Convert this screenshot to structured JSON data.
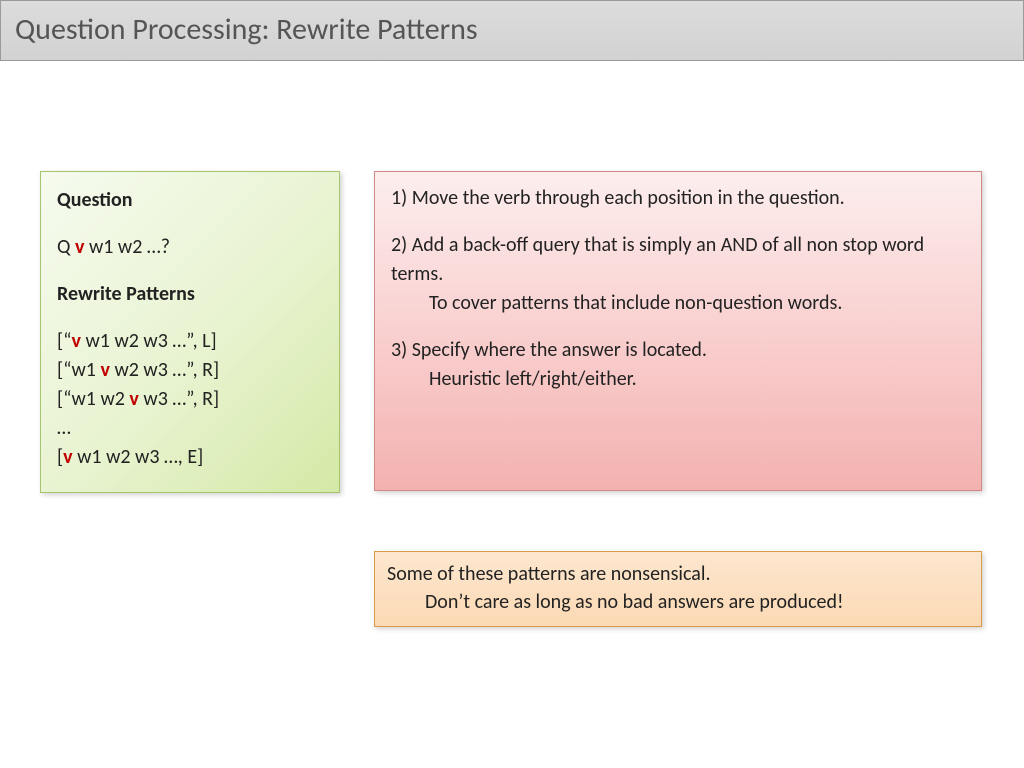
{
  "title": "Question Processing: Rewrite Patterns",
  "left": {
    "h1": "Question",
    "q_pre": "Q ",
    "q_v": "v",
    "q_post": " w1 w2 …?",
    "h2": "Rewrite Patterns",
    "p1_pre": "[“",
    "p1_v": "v",
    "p1_post": " w1 w2 w3 …”, L]",
    "p2_pre": "[“w1 ",
    "p2_v": "v",
    "p2_post": " w2 w3 …”, R]",
    "p3_pre": "[“w1 w2 ",
    "p3_v": "v",
    "p3_post": " w3 …”, R]",
    "dots": "…",
    "p4_pre": "[",
    "p4_v": "v",
    "p4_post": " w1 w2 w3 …,   E]"
  },
  "right": {
    "l1": "1) Move the verb through each position in the question.",
    "l2": "2) Add a back-off query that is simply an AND of all non stop word terms.",
    "l2b": "To cover patterns that include non-question words.",
    "l3": "3) Specify where the answer is located.",
    "l3b": "Heuristic left/right/either."
  },
  "note": {
    "l1": "Some of these patterns are nonsensical.",
    "l2": "Don’t care as long as no bad answers are produced!"
  }
}
